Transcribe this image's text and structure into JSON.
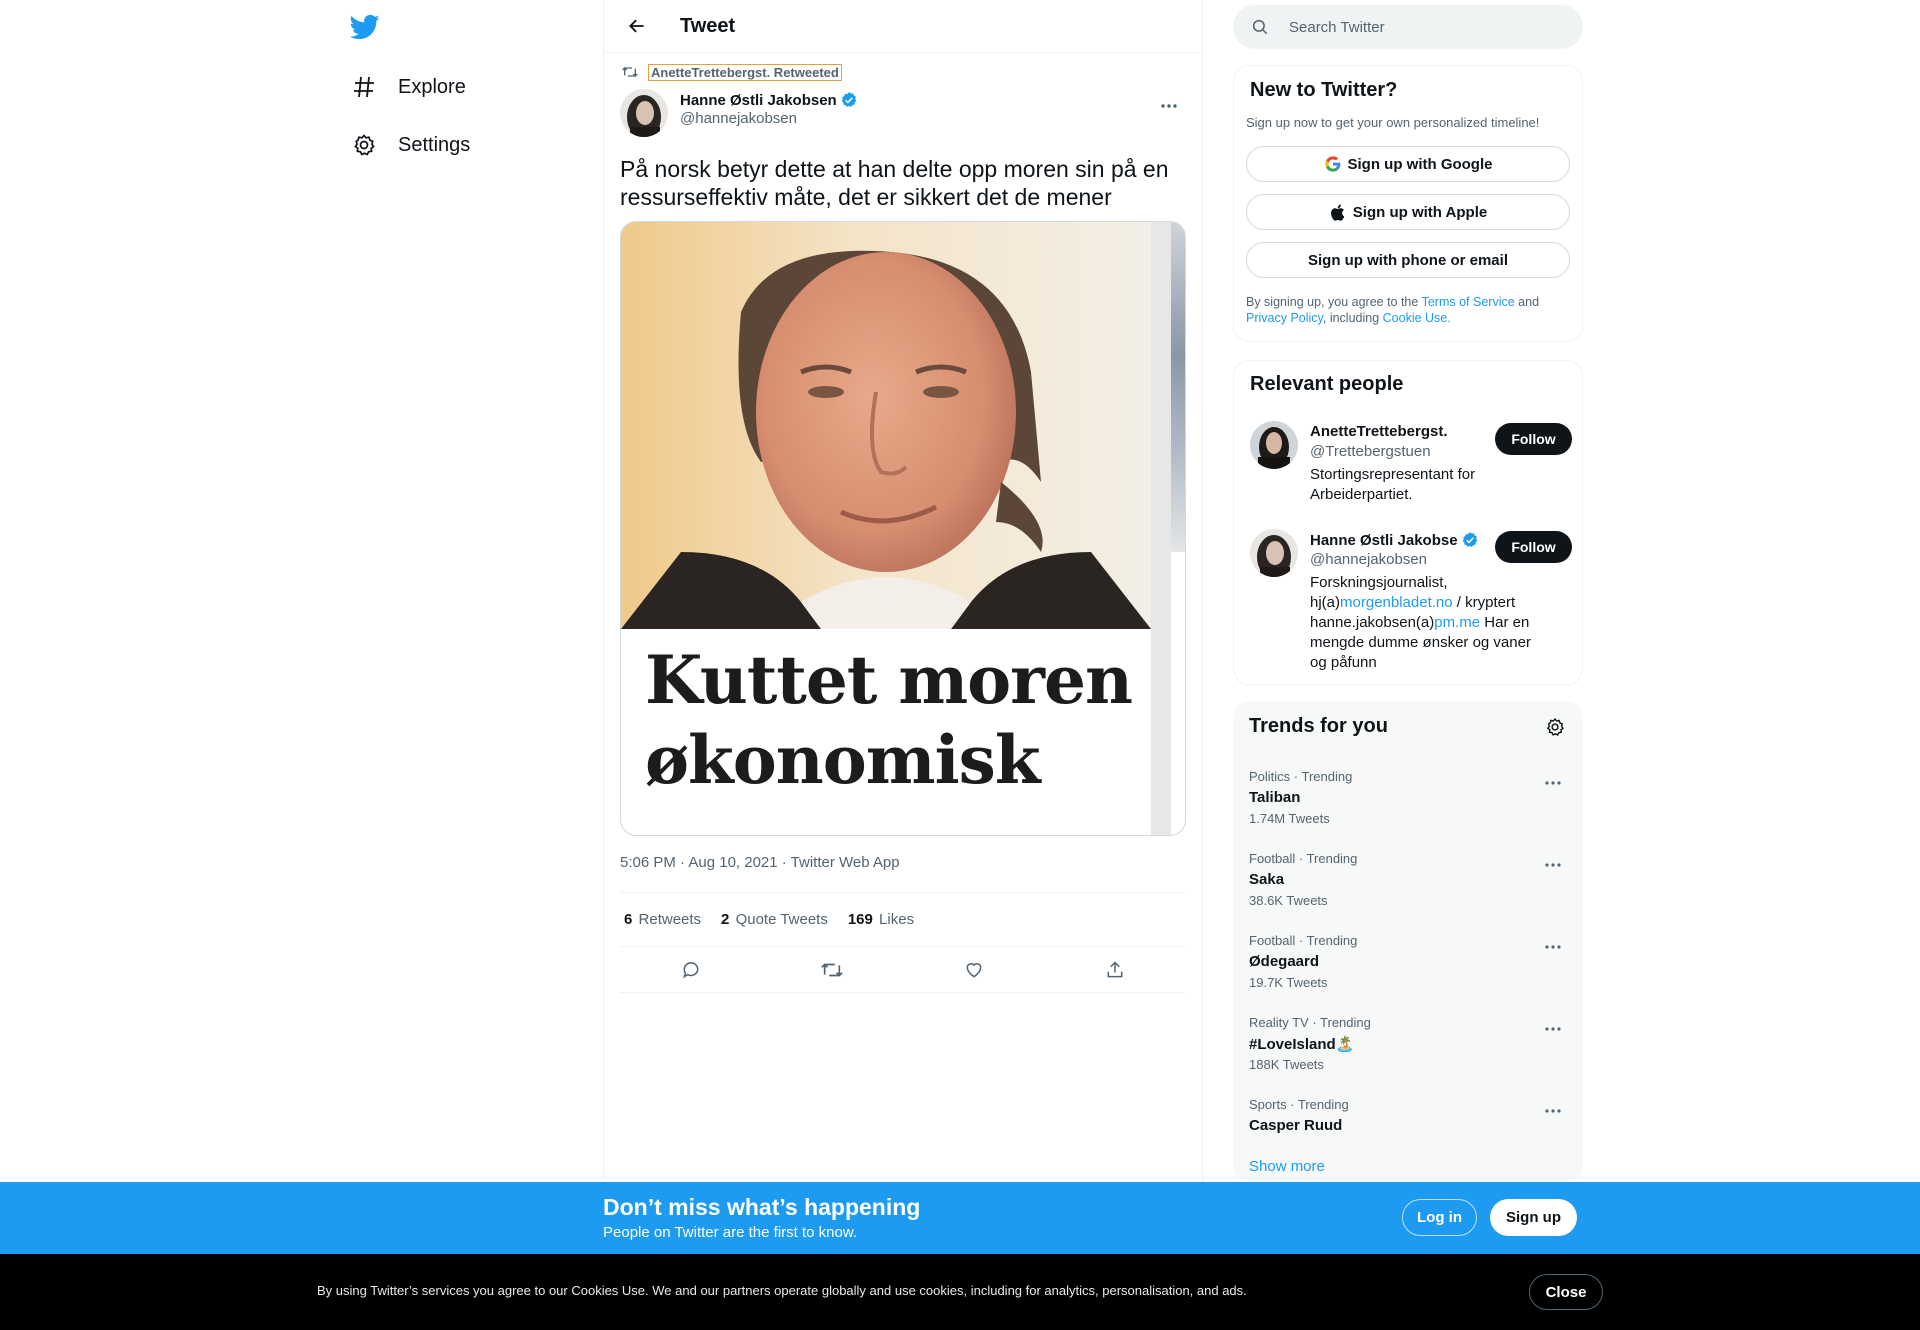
{
  "nav": {
    "items": [
      {
        "label": "Explore",
        "icon": "hashtag-icon"
      },
      {
        "label": "Settings",
        "icon": "gear-icon"
      }
    ]
  },
  "header": {
    "title": "Tweet"
  },
  "tweet": {
    "retweeted_by": "AnetteTrettebergst. Retweeted",
    "author_name": "Hanne Østli Jakobsen",
    "author_handle": "@hannejakobsen",
    "text": "På norsk betyr dette at han delte opp moren sin på en ressurseffektiv måte, det er sikkert det de mener",
    "image_headline_1": "Kuttet moren",
    "image_headline_2": "økonomisk",
    "meta": "5:06 PM · Aug 10, 2021 · Twitter Web App",
    "stats": {
      "retweets_count": "6",
      "retweets_label": "Retweets",
      "quotes_count": "2",
      "quotes_label": "Quote Tweets",
      "likes_count": "169",
      "likes_label": "Likes"
    }
  },
  "search": {
    "placeholder": "Search Twitter"
  },
  "new_to_twitter": {
    "title": "New to Twitter?",
    "subtitle": "Sign up now to get your own personalized timeline!",
    "google": "Sign up with Google",
    "apple": "Sign up with Apple",
    "phone": "Sign up with phone or email",
    "legal_1": "By signing up, you agree to the ",
    "terms": "Terms of Service",
    "legal_2": " and ",
    "privacy": "Privacy Policy",
    "legal_3": ", including ",
    "cookie": "Cookie Use."
  },
  "relevant_people": {
    "title": "Relevant people",
    "people": [
      {
        "name": "AnetteTrettebergst.",
        "handle": "@Trettebergstuen",
        "bio": "Stortingsrepresentant for Arbeiderpartiet.",
        "follow": "Follow"
      },
      {
        "name": "Hanne Østli Jakobse",
        "handle": "@hannejakobsen",
        "bio_1": "Forskningsjournalist, hj(a)",
        "bio_link_1": "morgenbladet.no",
        "bio_2": " / kryptert hanne.jakobsen(a)",
        "bio_link_2": "pm.me",
        "bio_3": " Har en mengde dumme ønsker og vaner og påfunn",
        "follow": "Follow"
      }
    ]
  },
  "trends": {
    "title": "Trends for you",
    "items": [
      {
        "category": "Politics · Trending",
        "name": "Taliban",
        "count": "1.74M Tweets"
      },
      {
        "category": "Football · Trending",
        "name": "Saka",
        "count": "38.6K Tweets"
      },
      {
        "category": "Football · Trending",
        "name": "Ødegaard",
        "count": "19.7K Tweets"
      },
      {
        "category": "Reality TV · Trending",
        "name": "#LoveIsland🏝️",
        "count": "188K Tweets"
      },
      {
        "category": "Sports · Trending",
        "name": "Casper Ruud",
        "count": ""
      }
    ],
    "show_more": "Show more"
  },
  "bottom_bar": {
    "title": "Don’t miss what’s happening",
    "subtitle": "People on Twitter are the first to know.",
    "login": "Log in",
    "signup": "Sign up"
  },
  "cookie_bar": {
    "text": "By using Twitter’s services you agree to our Cookies Use. We and our partners operate globally and use cookies, including for analytics, personalisation, and ads.",
    "close": "Close"
  },
  "colors": {
    "accent": "#1d9bf0",
    "text": "#0f1419",
    "secondary": "#536471"
  }
}
